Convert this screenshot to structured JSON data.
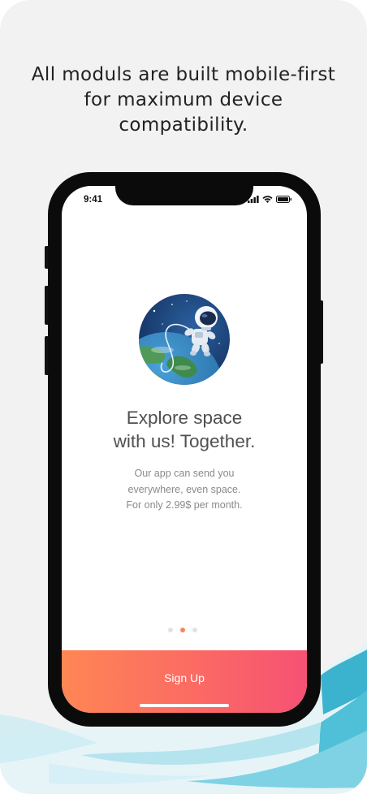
{
  "headline": {
    "line1": "All moduls are built mobile-first",
    "line2": "for maximum device",
    "line3": "compatibility."
  },
  "status_bar": {
    "time": "9:41",
    "icons": [
      "cellular-signal-icon",
      "wifi-icon",
      "battery-icon"
    ]
  },
  "onboarding": {
    "illustration": "astronaut-over-earth",
    "title_line1": "Explore space",
    "title_line2": "with us! Together.",
    "desc_line1": "Our app can send you",
    "desc_line2": "everywhere, even space.",
    "desc_line3": "For only 2.99$ per month.",
    "page_count": 3,
    "active_page": 2
  },
  "signup_button": {
    "label": "Sign Up"
  },
  "colors": {
    "accent_start": "#fe8654",
    "accent_end": "#f65174",
    "active_dot": "#f08a5d",
    "background": "#f2f2f2",
    "brush": "#3bb3cf"
  }
}
